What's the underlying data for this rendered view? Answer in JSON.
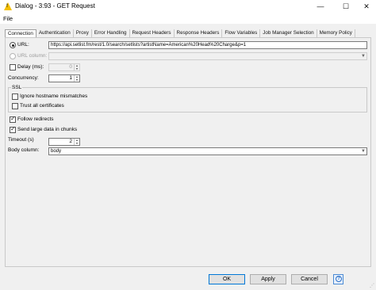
{
  "window": {
    "title": "Dialog - 3:93 - GET Request",
    "icon_glyph": "!",
    "minimize_glyph": "—",
    "maximize_glyph": "☐",
    "close_glyph": "✕"
  },
  "menu": {
    "file": "File"
  },
  "tabs": [
    {
      "label": "Connection",
      "active": true
    },
    {
      "label": "Authentication"
    },
    {
      "label": "Proxy"
    },
    {
      "label": "Error Handling"
    },
    {
      "label": "Request Headers"
    },
    {
      "label": "Response Headers"
    },
    {
      "label": "Flow Variables"
    },
    {
      "label": "Job Manager Selection"
    },
    {
      "label": "Memory Policy"
    }
  ],
  "connection": {
    "url_label": "URL:",
    "url_value": "https://api.setlist.fm/rest/1.0/search/setlists?artistName=American%20Head%20Charge&p=1",
    "url_column_label": "URL column:",
    "url_column_value": "",
    "delay_label": "Delay (ms):",
    "delay_value": "0",
    "concurrency_label": "Concurrency:",
    "concurrency_value": "1",
    "ssl_group_title": "SSL",
    "ignore_hostname_label": "Ignore hostname mismatches",
    "trust_all_label": "Trust all certificates",
    "follow_redirects_label": "Follow redirects",
    "send_chunks_label": "Send large data in chunks",
    "timeout_label": "Timeout (s)",
    "timeout_value": "2",
    "body_column_label": "Body column:",
    "body_column_value": "body"
  },
  "buttons": {
    "ok": "OK",
    "apply": "Apply",
    "cancel": "Cancel",
    "help_glyph": "?"
  },
  "colors": {
    "accent": "#0078d7",
    "warning_icon": "#f5c000"
  }
}
